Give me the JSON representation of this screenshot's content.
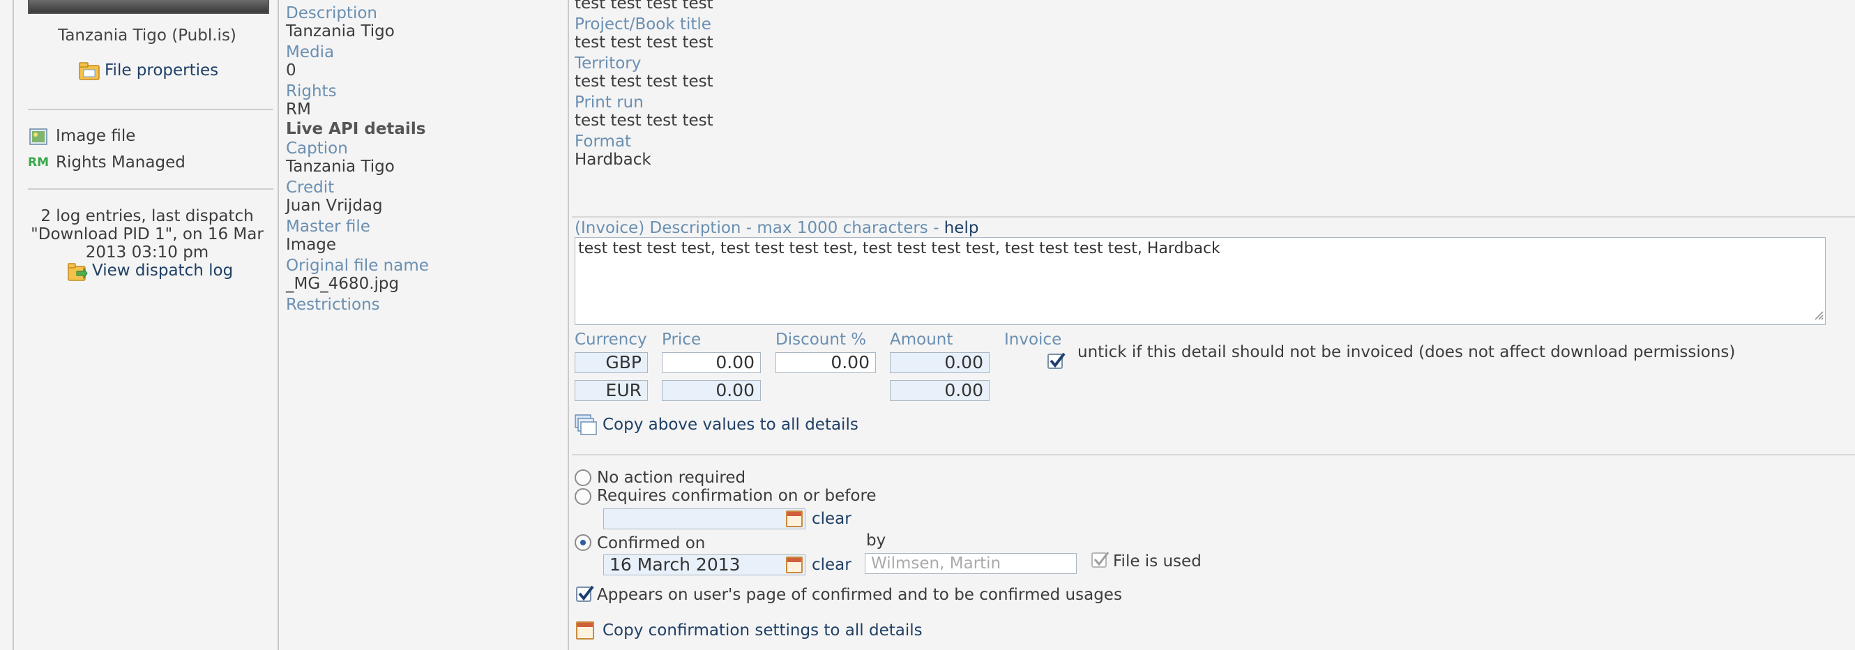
{
  "left": {
    "thumb_caption": "Tanzania Tigo (Publ.is)",
    "file_properties": "File properties",
    "image_file": "Image file",
    "rm_badge": "RM",
    "rights_managed": "Rights Managed",
    "log_text_1": "2 log entries, last dispatch",
    "log_text_2": "\"Download PID 1\", on 16 Mar",
    "log_text_3": "2013 03:10 pm",
    "view_dispatch_log": "View dispatch log"
  },
  "middle": {
    "description_label": "Description",
    "description_value": "Tanzania Tigo",
    "media_label": "Media",
    "media_value": "0",
    "rights_label": "Rights",
    "rights_value": "RM",
    "live_api_heading": "Live API details",
    "caption_label": "Caption",
    "caption_value": "Tanzania Tigo",
    "credit_label": "Credit",
    "credit_value": "Juan Vrijdag",
    "master_file_label": "Master file",
    "master_file_value": "Image",
    "original_file_name_label": "Original file name",
    "original_file_name_value": "_MG_4680.jpg",
    "restrictions_label": "Restrictions"
  },
  "right": {
    "top_value": "test test test test",
    "project_label": "Project/Book title",
    "project_value": "test test test test",
    "territory_label": "Territory",
    "territory_value": "test test test test",
    "print_run_label": "Print run",
    "print_run_value": "test test test test",
    "format_label": "Format",
    "format_value": "Hardback",
    "invoice_desc_label": "(Invoice) Description - max 1000 characters - ",
    "help_link": "help",
    "invoice_desc_value": "test test test test, test test test test, test test test test, test test test test, Hardback",
    "pricing": {
      "currency_header": "Currency",
      "price_header": "Price",
      "discount_header": "Discount %",
      "amount_header": "Amount",
      "invoice_header": "Invoice",
      "row1_currency": "GBP",
      "row1_price": "0.00",
      "row1_discount": "0.00",
      "row1_amount": "0.00",
      "row2_currency": "EUR",
      "row2_price": "0.00",
      "row2_amount": "0.00",
      "invoice_note": "untick if this detail should not be invoiced (does not affect download permissions)"
    },
    "copy_values_link": "Copy above values to all details",
    "confirmation": {
      "no_action": "No action required",
      "requires_confirmation": "Requires confirmation on or before",
      "clear_1": "clear",
      "confirmed_on": "Confirmed on",
      "confirmed_date": "16 March 2013",
      "clear_2": "clear",
      "by_label": "by",
      "by_value": "Wilmsen, Martin",
      "file_is_used": "File is used",
      "appears_on_page": "Appears on user's page of confirmed and to be confirmed usages"
    },
    "copy_confirmation_link": "Copy confirmation settings to all details"
  }
}
